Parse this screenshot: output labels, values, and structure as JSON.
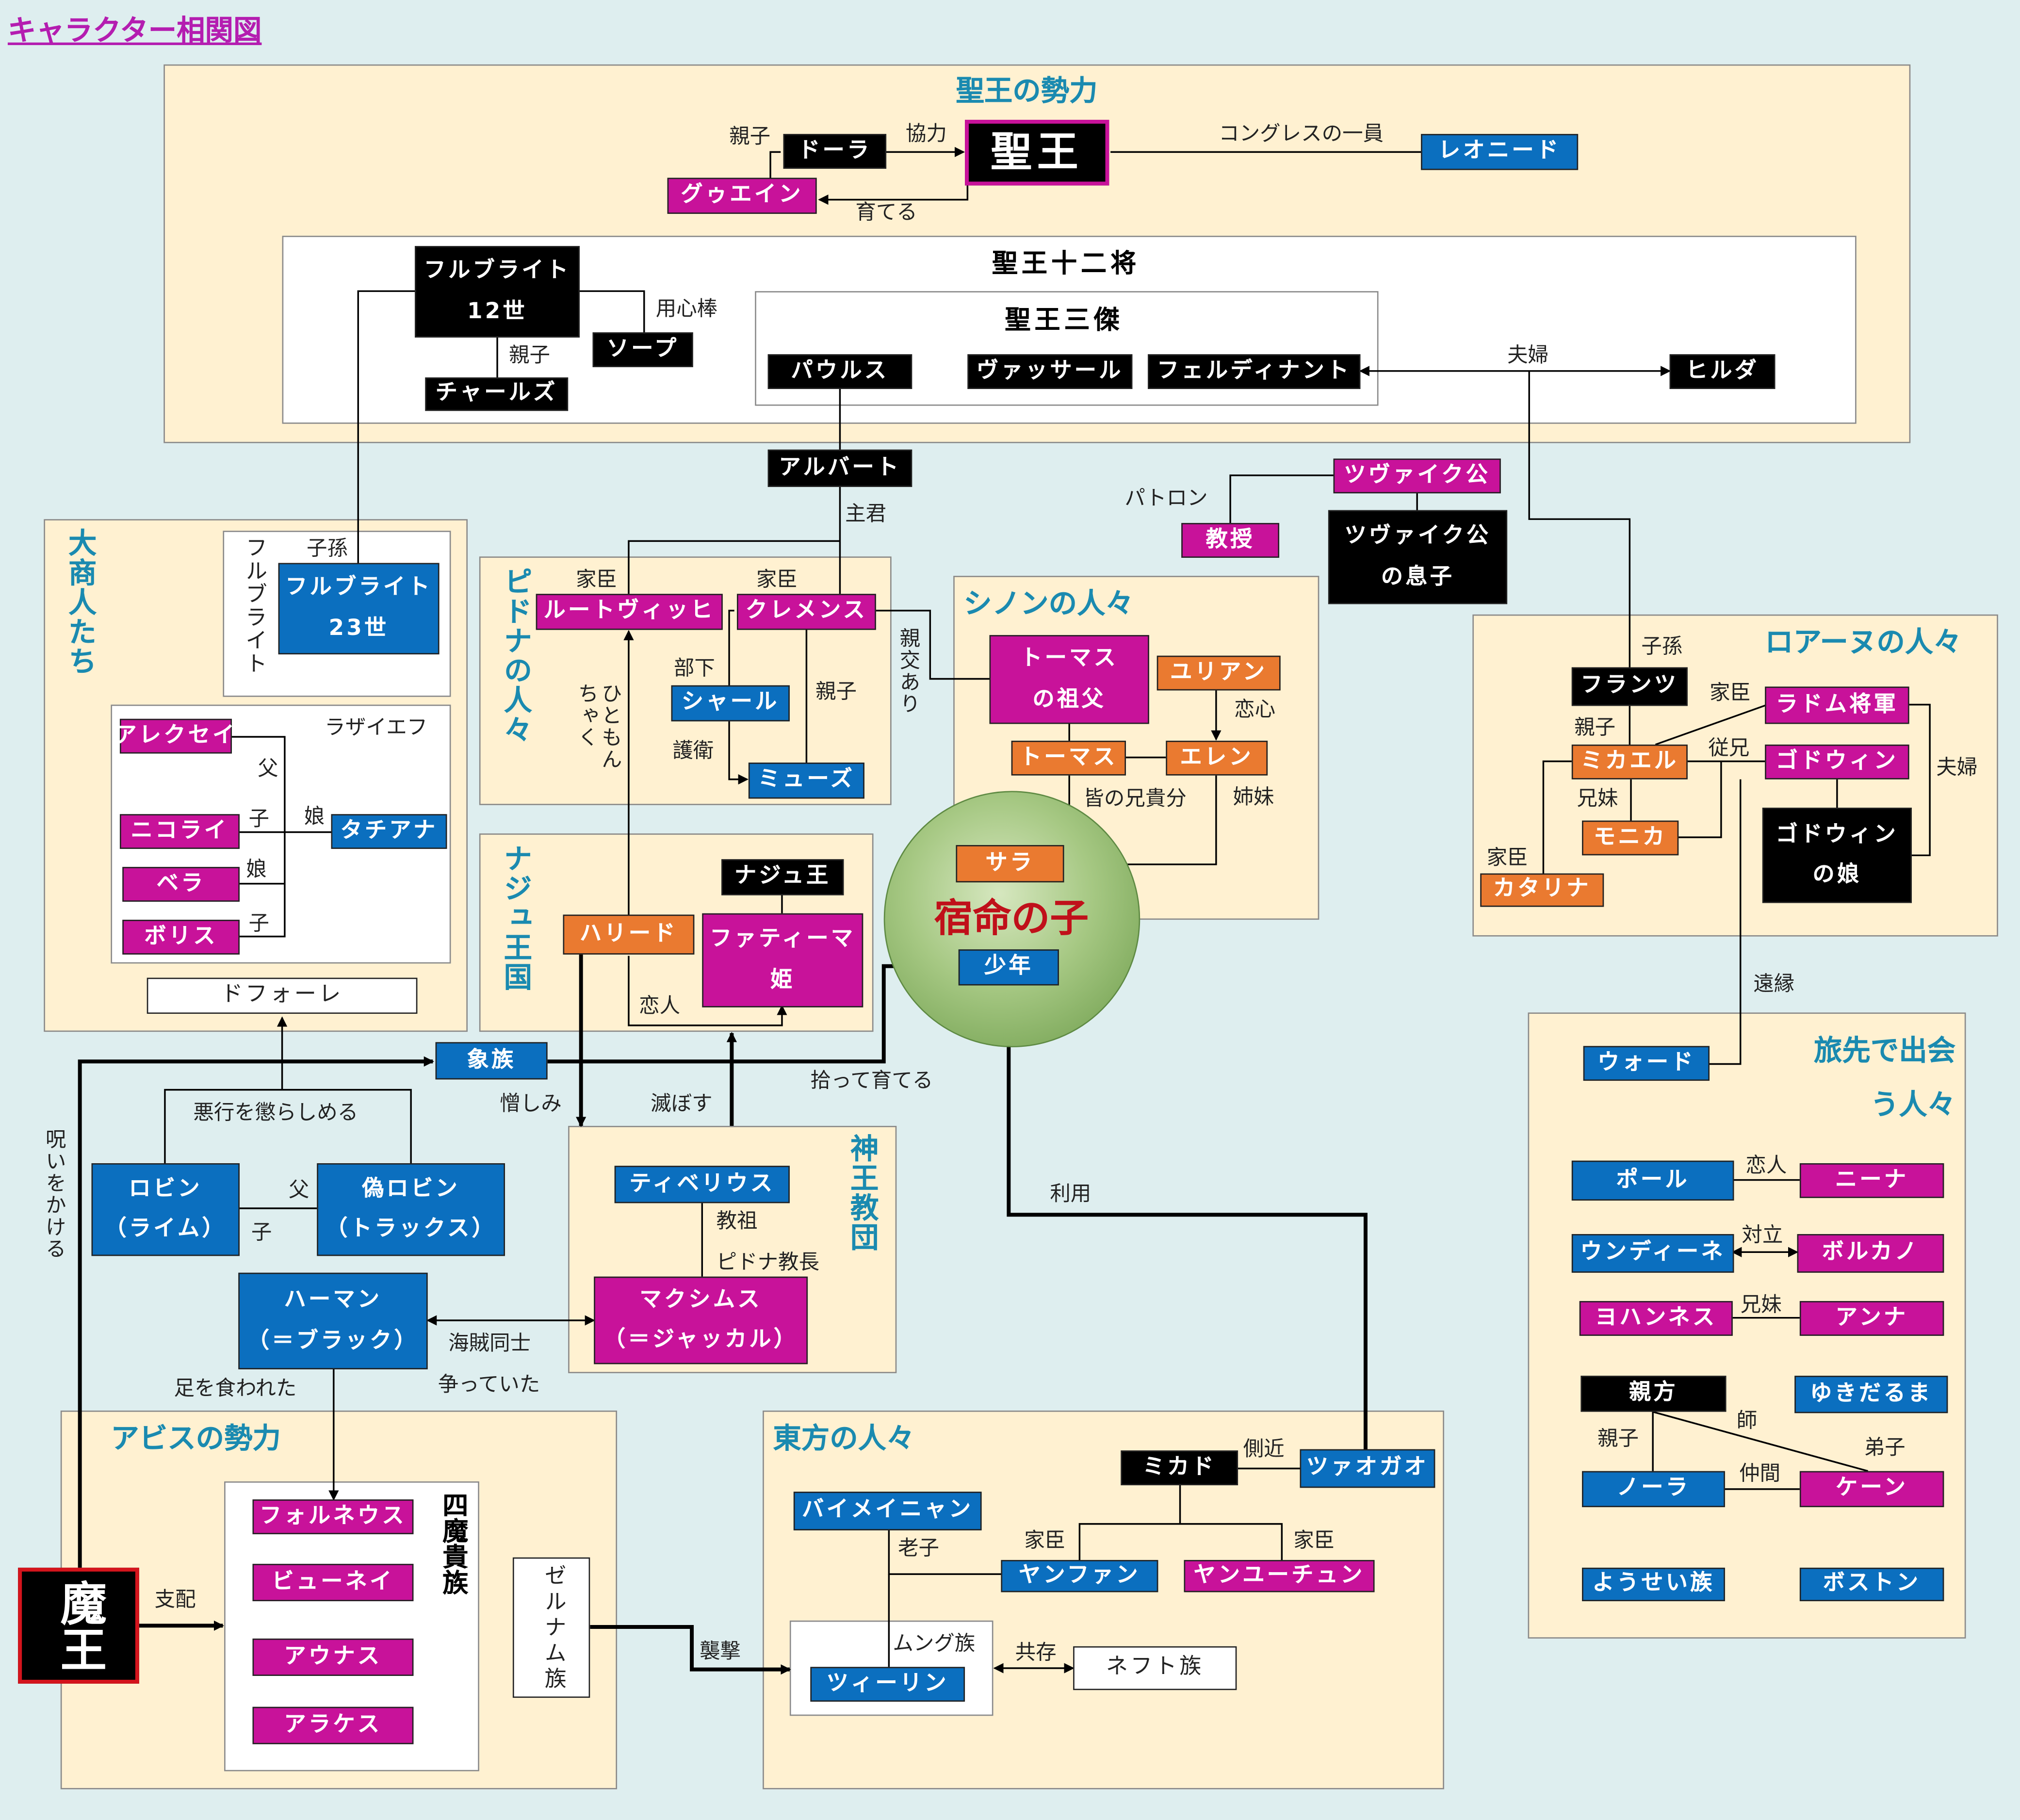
{
  "title": "キャラクター相関図",
  "groups": {
    "seio_power": "聖王の勢力",
    "twelve_generals": "聖王十二将",
    "three_heroes": "聖王三傑",
    "merchants": "大商人たち",
    "pidona": "ピドナの人々",
    "najyu": "ナジュ王国",
    "shinon": "シノンの人々",
    "loarne": "ロアーヌの人々",
    "travel": "旅先で出会う人々",
    "shinou": "神王教団",
    "abyss": "アビスの勢力",
    "four_nobles": "四魔貴族",
    "east": "東方の人々"
  },
  "nodes": {
    "dora": "ドーラ",
    "seio": "聖王",
    "leonid": "レオニード",
    "gwein": "グゥエイン",
    "fulbright12a": "フルブライト",
    "fulbright12b": "12世",
    "soap": "ソープ",
    "charles": "チャールズ",
    "paulus": "パウルス",
    "vassar": "ヴァッサール",
    "ferdinand": "フェルディナント",
    "hilda": "ヒルダ",
    "albert": "アルバート",
    "zwei": "ツヴァイク公",
    "zwei_son_a": "ツヴァイク公",
    "zwei_son_b": "の息子",
    "professor": "教授",
    "fulbright_label": "フルブライト",
    "fulbright23a": "フルブライト",
    "fulbright23b": "23世",
    "alexei": "アレクセイ",
    "lazaiev": "ラザイエフ",
    "nikolai": "ニコライ",
    "tatiana": "タチアナ",
    "bella": "ベラ",
    "boris": "ボリス",
    "dforeille": "ドフォーレ",
    "ludwig": "ルートヴィッヒ",
    "clemens": "クレメンス",
    "sharl": "シャール",
    "muse": "ミューズ",
    "najyu_king": "ナジュ王",
    "harid": "ハリード",
    "fatima_a": "ファティーマ",
    "fatima_b": "姫",
    "thomas_gf_a": "トーマス",
    "thomas_gf_b": "の祖父",
    "julian": "ユリアン",
    "thomas": "トーマス",
    "ellen": "エレン",
    "sara": "サラ",
    "fate_child": "宿命の子",
    "boy": "少年",
    "franz": "フランツ",
    "radom": "ラドム将軍",
    "mikhail": "ミカエル",
    "godwin": "ゴドウィン",
    "godwin_d_a": "ゴドウィン",
    "godwin_d_b": "の娘",
    "monica": "モニカ",
    "katarina": "カタリナ",
    "zou": "象族",
    "ward": "ウォード",
    "paul": "ポール",
    "nina": "ニーナ",
    "undine": "ウンディーネ",
    "volcano": "ボルカノ",
    "johannes": "ヨハンネス",
    "anna": "アンナ",
    "oyakata": "親方",
    "yukidaruma": "ゆきだるま",
    "nora": "ノーラ",
    "ken": "ケーン",
    "fairy": "ようせい族",
    "boston": "ボストン",
    "robin_a": "ロビン",
    "robin_b": "（ライム）",
    "fake_robin_a": "偽ロビン",
    "fake_robin_b": "（トラックス）",
    "tiberius": "ティベリウス",
    "maximus_a": "マクシムス",
    "maximus_b": "（＝ジャッカル）",
    "harman_a": "ハーマン",
    "harman_b": "（＝ブラック）",
    "forneus": "フォルネウス",
    "byunei": "ビューネイ",
    "aunas": "アウナス",
    "arakes": "アラケス",
    "zelnam": "ゼルナム族",
    "maou": "魔王",
    "mikado": "ミカド",
    "tsuaogao": "ツァオガオ",
    "baimei": "バイメイニャン",
    "yanfan": "ヤンファン",
    "yanyuchun": "ヤンユーチュン",
    "mung": "ムング族",
    "tiilin": "ツィーリン",
    "neft": "ネフト族"
  },
  "labels": {
    "oyako1": "親子",
    "kyoryoku": "協力",
    "sodateru": "育てる",
    "congress": "コングレスの一員",
    "youjinbou": "用心棒",
    "oyako2": "親子",
    "fuufu1": "夫婦",
    "patron": "パトロン",
    "shukun": "主君",
    "shison1": "子孫",
    "chichi": "父",
    "ko1": "子",
    "musume1": "娘",
    "musume2": "娘",
    "ko2": "子",
    "kashin1": "家臣",
    "kashin2": "家臣",
    "shinkou": "親交あり",
    "hitomonchaku": "ひともんちゃく",
    "buka": "部下",
    "oyako3": "親子",
    "goei": "護衛",
    "koibito1": "恋人",
    "koigokoro": "恋心",
    "mina": "皆の兄貴分",
    "shimai": "姉妹",
    "shison2": "子孫",
    "kashin3": "家臣",
    "oyako4": "親子",
    "itoko": "従兄",
    "kyoudai": "兄妹",
    "fuufu2": "夫婦",
    "kashin4": "家臣",
    "enen": "遠縁",
    "hirotte": "拾って育てる",
    "norowai": "呪いをかける",
    "akugyou": "悪行を懲らしめる",
    "nikushimi": "憎しみ",
    "horobosu": "滅ぼす",
    "chichi2": "父",
    "ko3": "子",
    "kyouso": "教祖",
    "pidona_kyouchou": "ピドナ教長",
    "riyou": "利用",
    "kaizoku": "海賊同士",
    "arasotte": "争っていた",
    "ashi": "足を食われた",
    "shihai": "支配",
    "shuugeki": "襲撃",
    "sokkin": "側近",
    "kashin5": "家臣",
    "kashin6": "家臣",
    "roushi": "老子",
    "kyouzon": "共存",
    "koibito2": "恋人",
    "tairitsu": "対立",
    "kyoudai2": "兄妹",
    "shi": "師",
    "deshi": "弟子",
    "nakama": "仲間"
  },
  "colors": {
    "background": "#deeeef",
    "group_fill": "#fff1d1",
    "black": "#000000",
    "magenta": "#c8129a",
    "blue": "#0b6fbf",
    "orange": "#ea7a30",
    "group_title": "#1a8ab0",
    "fate_text": "#c0101a",
    "title": "#b41db0"
  }
}
